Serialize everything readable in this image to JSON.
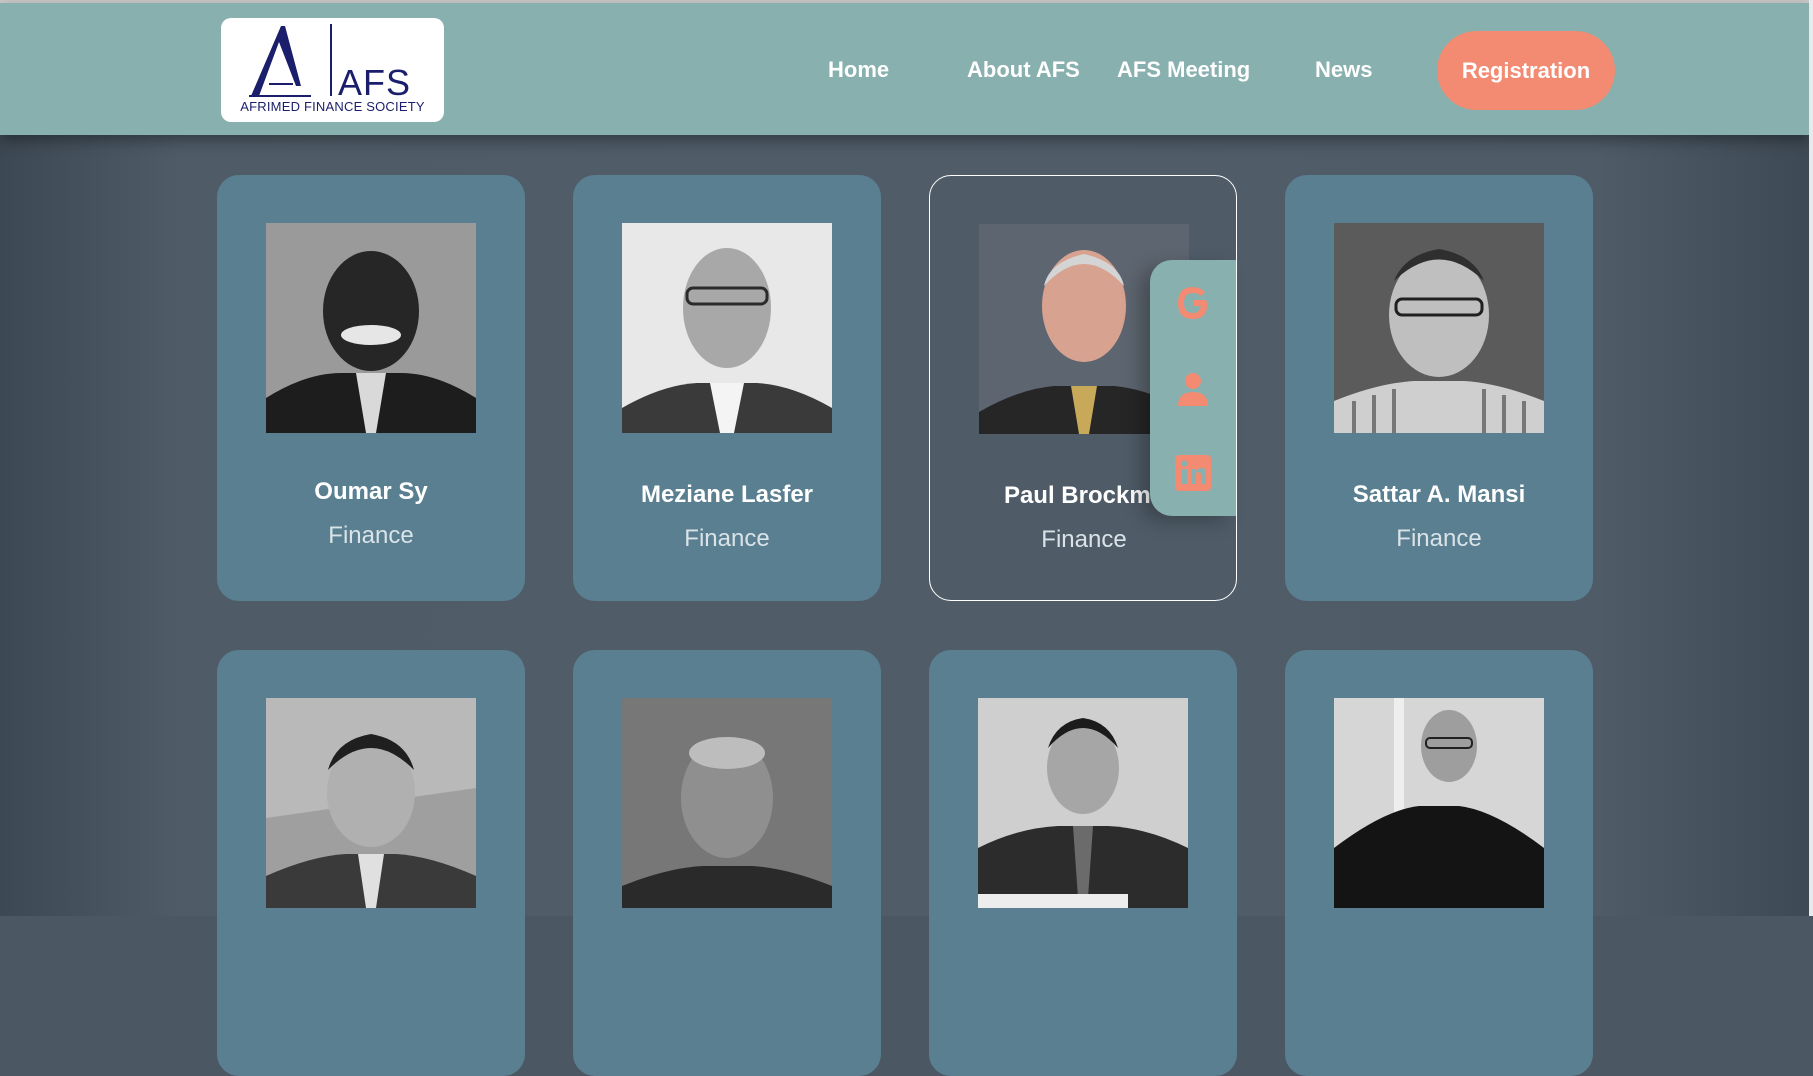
{
  "header": {
    "logo": {
      "abbr": "AFS",
      "caption": "AFRIMED FINANCE SOCIETY"
    },
    "nav": [
      {
        "label": "Home"
      },
      {
        "label": "About AFS"
      },
      {
        "label": "AFS Meeting"
      },
      {
        "label": "News"
      }
    ],
    "registration_label": "Registration"
  },
  "members": [
    {
      "name": "Oumar Sy",
      "department": "Finance"
    },
    {
      "name": "Meziane Lasfer",
      "department": "Finance"
    },
    {
      "name": "Paul Brockma",
      "department": "Finance"
    },
    {
      "name": "Sattar A. Mansi",
      "department": "Finance"
    },
    {
      "name": "",
      "department": ""
    },
    {
      "name": "",
      "department": ""
    },
    {
      "name": "",
      "department": ""
    },
    {
      "name": "",
      "department": ""
    }
  ],
  "social_icons": [
    "google-icon",
    "person-icon",
    "linkedin-icon"
  ],
  "colors": {
    "header_bg": "#88b0ae",
    "card_bg": "#5a7f91",
    "accent": "#f28b72",
    "page_bg": "#4f5c68"
  }
}
